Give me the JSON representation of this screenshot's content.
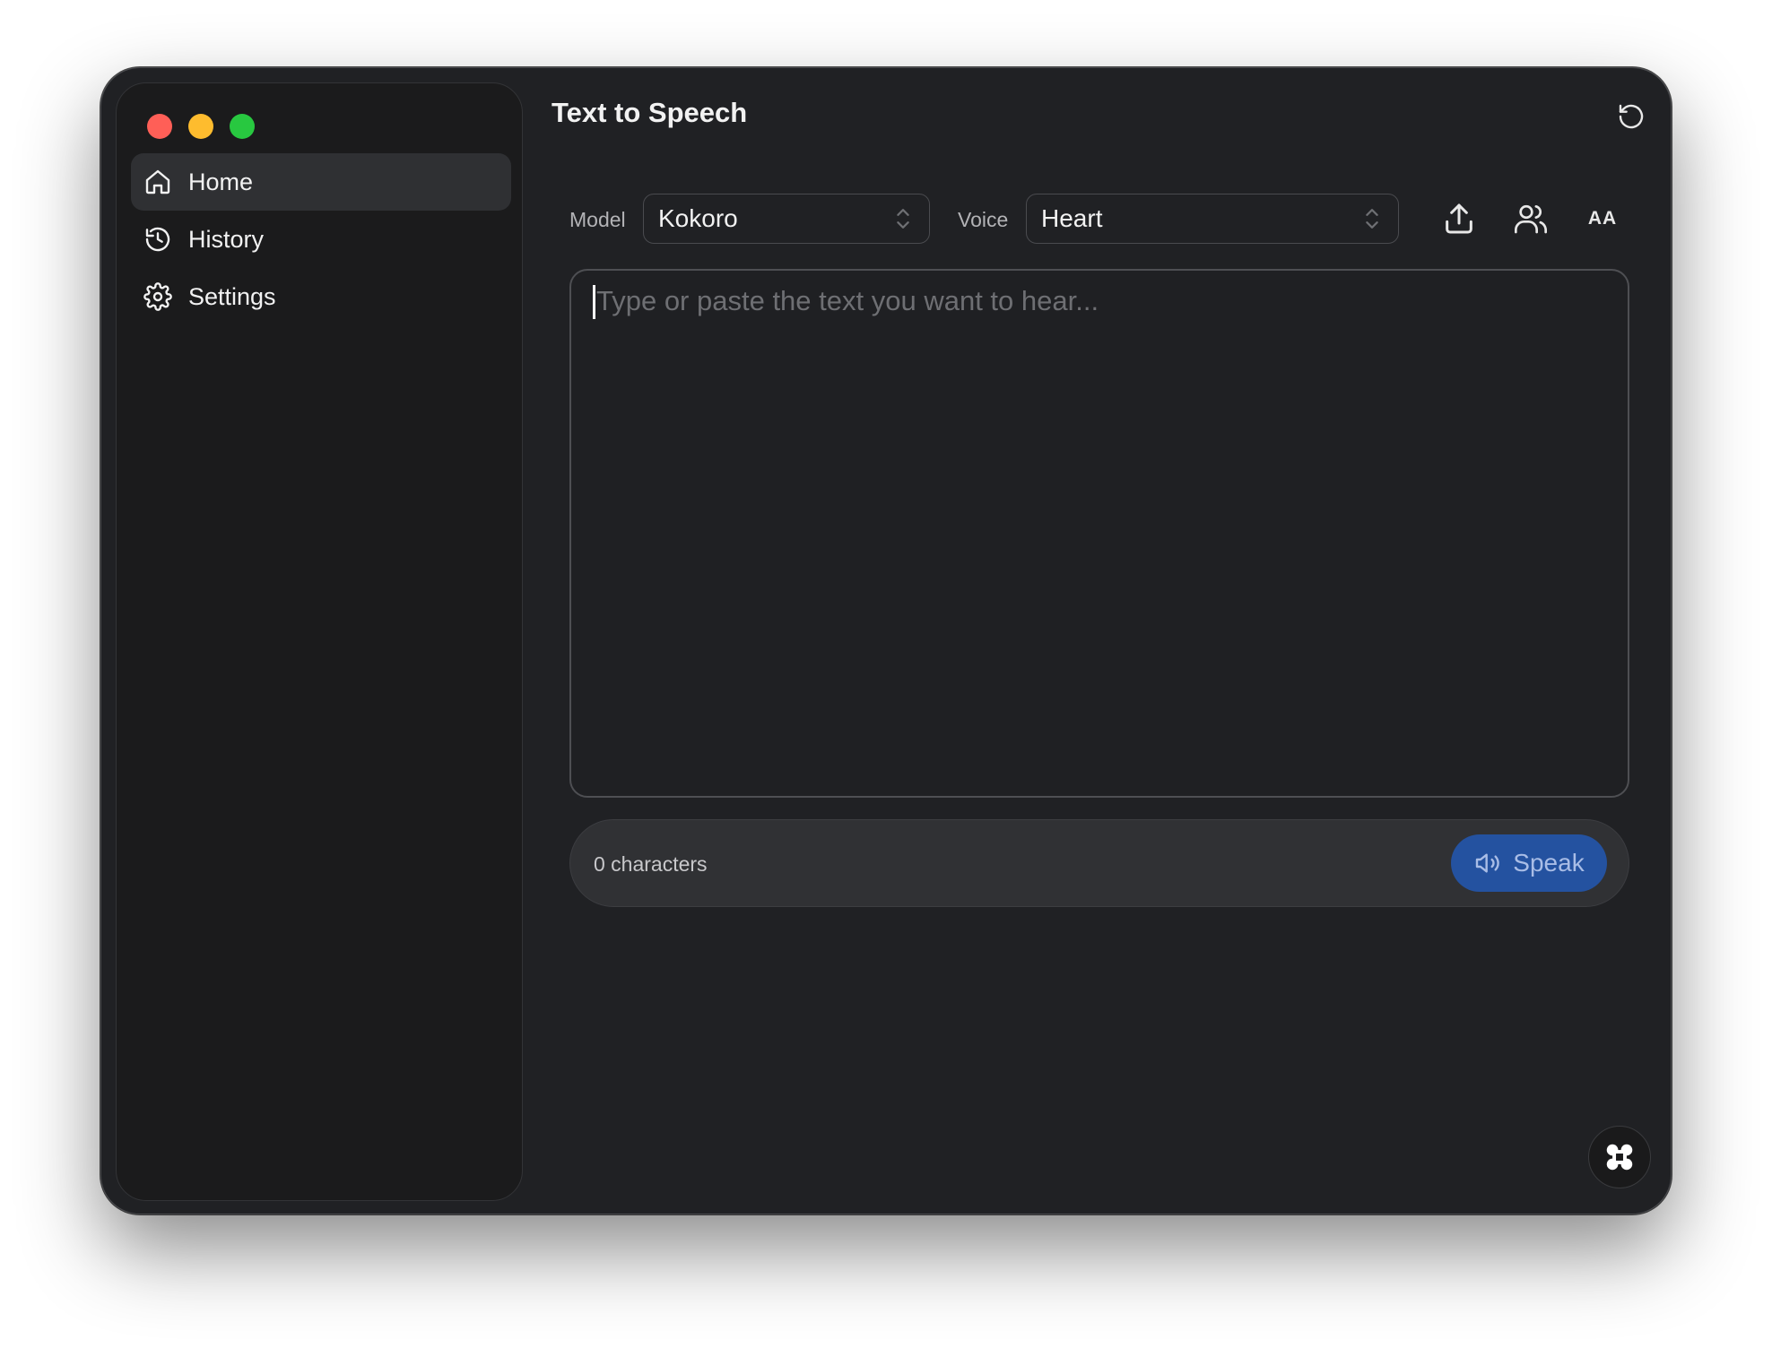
{
  "window": {
    "title": "Text to Speech",
    "traffic_colors": [
      "#ff5f57",
      "#febc2e",
      "#28c840"
    ]
  },
  "sidebar": {
    "items": [
      {
        "label": "Home",
        "icon": "home-icon",
        "active": true
      },
      {
        "label": "History",
        "icon": "history-icon",
        "active": false
      },
      {
        "label": "Settings",
        "icon": "gear-icon",
        "active": false
      }
    ]
  },
  "header": {
    "reset_icon": "refresh-icon"
  },
  "toolbar": {
    "model_label": "Model",
    "model_value": "Kokoro",
    "voice_label": "Voice",
    "voice_value": "Heart",
    "icons": [
      "upload-icon",
      "users-icon",
      "font-size-icon"
    ],
    "font_size_glyph": "AA"
  },
  "editor": {
    "placeholder": "Type or paste the text you want to hear...",
    "value": ""
  },
  "footer": {
    "char_count": "0 characters",
    "speak_label": "Speak",
    "speak_icon": "speaker-icon",
    "accent_color": "#2452a0"
  },
  "floating": {
    "icon": "command-icon"
  }
}
